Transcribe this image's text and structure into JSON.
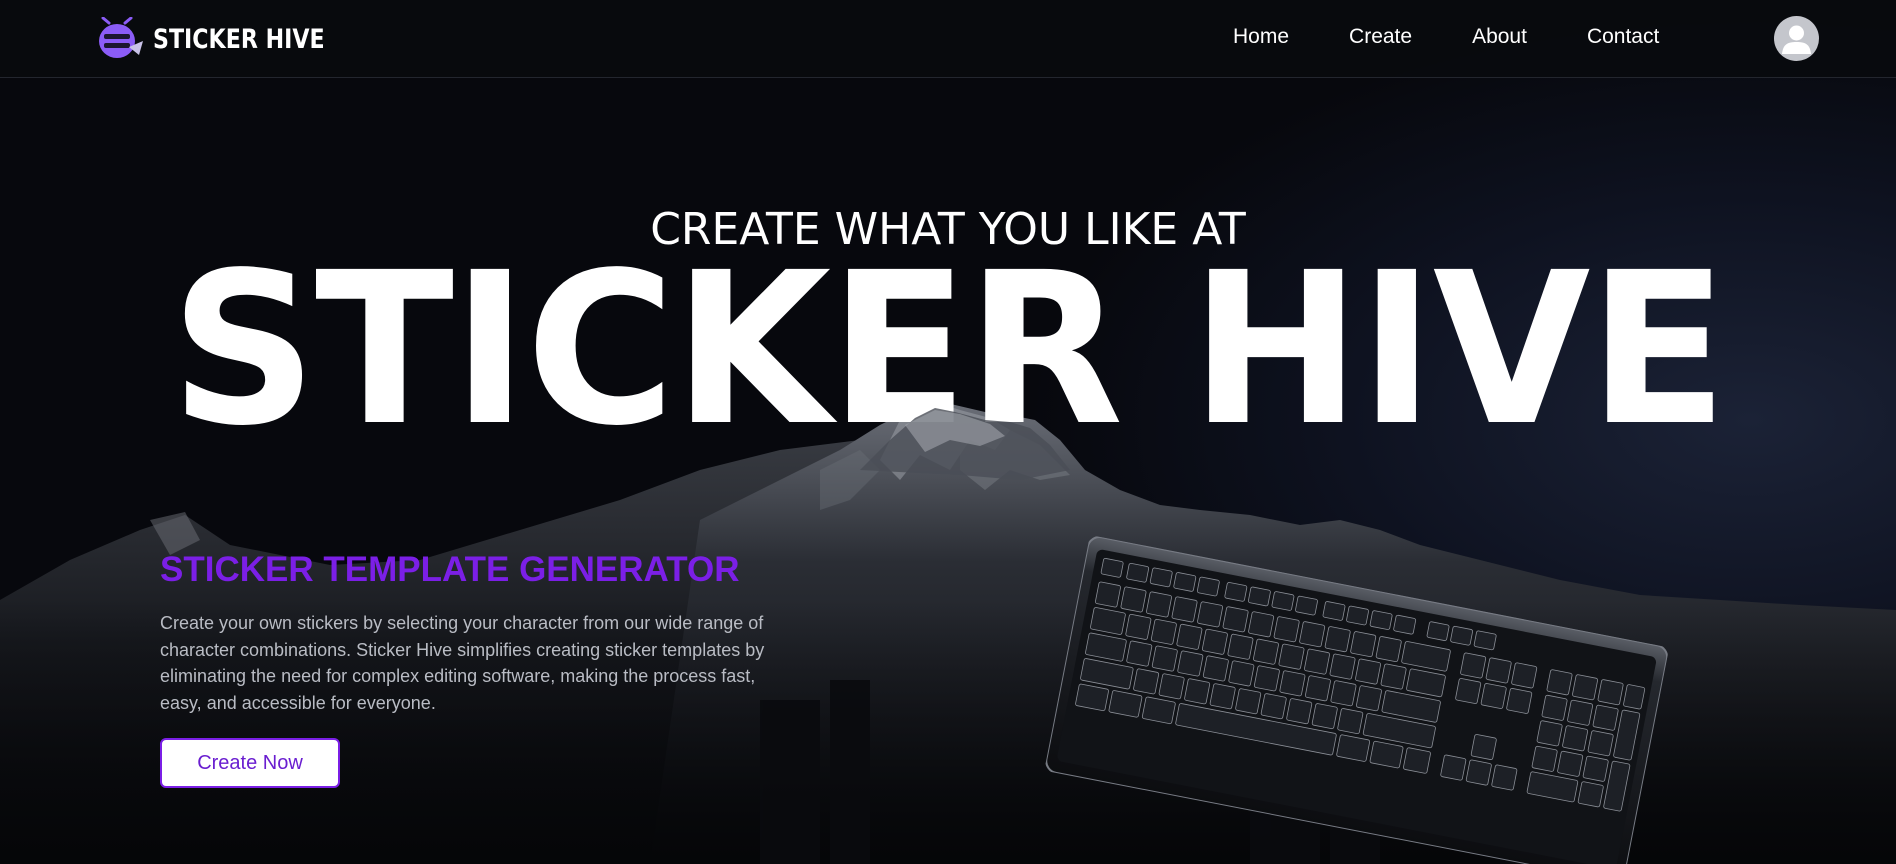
{
  "header": {
    "brand": "STICKER HIVE",
    "logo_icon": "bee-icon",
    "nav": [
      {
        "label": "Home"
      },
      {
        "label": "Create"
      },
      {
        "label": "About"
      },
      {
        "label": "Contact"
      }
    ],
    "avatar_icon": "user-avatar-icon"
  },
  "hero": {
    "subtitle": "CREATE WHAT YOU LIKE AT",
    "title": "STICKER HIVE"
  },
  "section": {
    "heading": "STICKER TEMPLATE GENERATOR",
    "body": "Create your own stickers by selecting your character from our wide range of character combinations. Sticker Hive simplifies creating sticker templates by eliminating the need for complex editing software, making the process fast, easy, and accessible for everyone.",
    "cta_label": "Create Now"
  },
  "colors": {
    "accent": "#7b1fe6",
    "background": "#05060a",
    "text_muted": "#b9bcc4"
  }
}
